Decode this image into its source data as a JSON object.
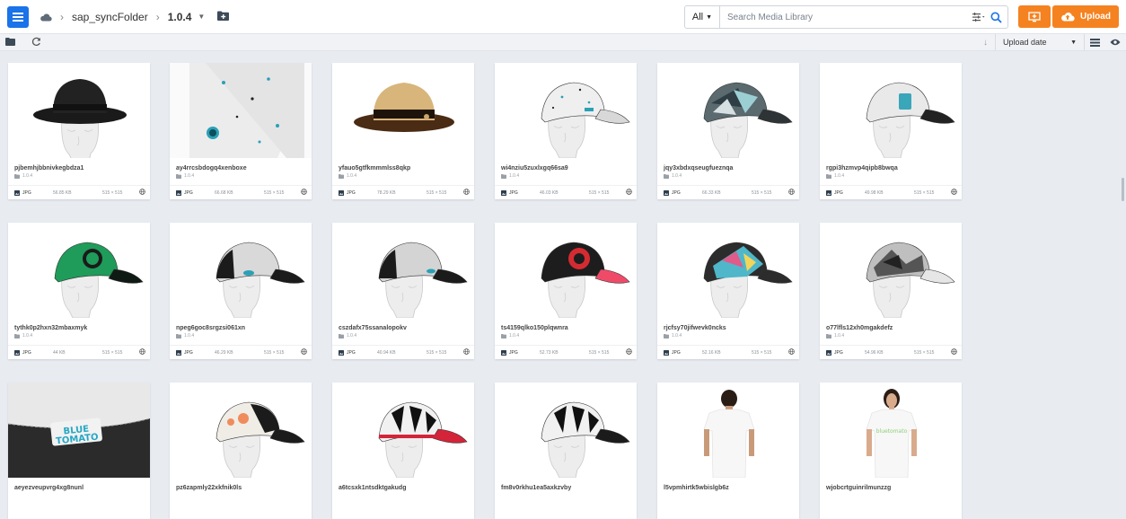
{
  "breadcrumb": {
    "root": "sap_syncFolder",
    "current": "1.0.4"
  },
  "search": {
    "filter": "All",
    "placeholder": "Search Media Library"
  },
  "upload_label": "Upload",
  "sort": {
    "label": "Upload date"
  },
  "assets": [
    {
      "name": "pjbemhjbbnivkegbdza1",
      "folder": "1.0.4",
      "type": "JPG",
      "size": "56.85 KB",
      "dims": "515 × 515",
      "thumb": "fedora-black"
    },
    {
      "name": "ay4rrcsbdogq4xenboxe",
      "folder": "1.0.4",
      "type": "JPG",
      "size": "66.68 KB",
      "dims": "515 × 515",
      "thumb": "cap-closeup-splatter"
    },
    {
      "name": "yfauo5gtfkmmmlss8qkp",
      "folder": "1.0.4",
      "type": "JPG",
      "size": "78.29 KB",
      "dims": "515 × 515",
      "thumb": "straw-fedora"
    },
    {
      "name": "wi4nziu5zuxlxgq66sa9",
      "folder": "1.0.4",
      "type": "JPG",
      "size": "46.03 KB",
      "dims": "515 × 515",
      "thumb": "cap-white-splatter"
    },
    {
      "name": "jqy3xbdxqseugfueznqa",
      "folder": "1.0.4",
      "type": "JPG",
      "size": "66.33 KB",
      "dims": "515 × 515",
      "thumb": "cap-camo"
    },
    {
      "name": "rgpi3hzmvp4qipb8bwqa",
      "folder": "1.0.4",
      "type": "JPG",
      "size": "49.98 KB",
      "dims": "515 × 515",
      "thumb": "cap-white-black-brim"
    },
    {
      "name": "tythk0p2hxn32mbaxmyk",
      "folder": "1.0.4",
      "type": "JPG",
      "size": "44 KB",
      "dims": "515 × 515",
      "thumb": "cap-green"
    },
    {
      "name": "npeg6goc8srgzsi061xn",
      "folder": "1.0.4",
      "type": "JPG",
      "size": "46.29 KB",
      "dims": "515 × 515",
      "thumb": "cap-grey-black"
    },
    {
      "name": "cszdafx75ssanalopokv",
      "folder": "1.0.4",
      "type": "JPG",
      "size": "40.94 KB",
      "dims": "515 × 515",
      "thumb": "cap-grey-black-2"
    },
    {
      "name": "ts4159qlko150plqwnra",
      "folder": "1.0.4",
      "type": "JPG",
      "size": "52.73 KB",
      "dims": "515 × 515",
      "thumb": "cap-black-pink"
    },
    {
      "name": "rjcfsy70jifwevk0ncks",
      "folder": "1.0.4",
      "type": "JPG",
      "size": "52.16 KB",
      "dims": "515 × 515",
      "thumb": "cap-pattern"
    },
    {
      "name": "o77lfls12xh0mgakdefz",
      "folder": "1.0.4",
      "type": "JPG",
      "size": "54.96 KB",
      "dims": "515 × 515",
      "thumb": "cap-graffiti"
    },
    {
      "name": "aeyezveupvrg4xg8nunl",
      "folder": "",
      "type": "",
      "size": "",
      "dims": "",
      "thumb": "label-closeup"
    },
    {
      "name": "pz6zapmly22xkfnik0ls",
      "folder": "",
      "type": "",
      "size": "",
      "dims": "",
      "thumb": "cap-trucker-white"
    },
    {
      "name": "a6tcsxk1ntsdktgakudg",
      "folder": "",
      "type": "",
      "size": "",
      "dims": "",
      "thumb": "cap-stripes-red"
    },
    {
      "name": "fm8v0rkhu1ea5axkzvby",
      "folder": "",
      "type": "",
      "size": "",
      "dims": "",
      "thumb": "cap-stripes"
    },
    {
      "name": "l5vpmhirtk5wbislgb6z",
      "folder": "",
      "type": "",
      "size": "",
      "dims": "",
      "thumb": "tshirt-back"
    },
    {
      "name": "wjobcrtguinrilmunzzg",
      "folder": "",
      "type": "",
      "size": "",
      "dims": "",
      "thumb": "tshirt-front"
    }
  ],
  "colors": {
    "accent": "#1a73e8",
    "upload": "#f58220",
    "background": "#e8ecf1"
  },
  "icons": [
    "menu-icon",
    "cloud-icon",
    "chevron-right-icon",
    "folder-plus-icon",
    "chevron-down-icon",
    "filter-icon",
    "search-icon",
    "present-icon",
    "cloud-upload-icon",
    "folder-icon",
    "refresh-icon",
    "arrow-down-icon",
    "list-view-icon",
    "eye-icon",
    "image-icon",
    "globe-icon"
  ]
}
